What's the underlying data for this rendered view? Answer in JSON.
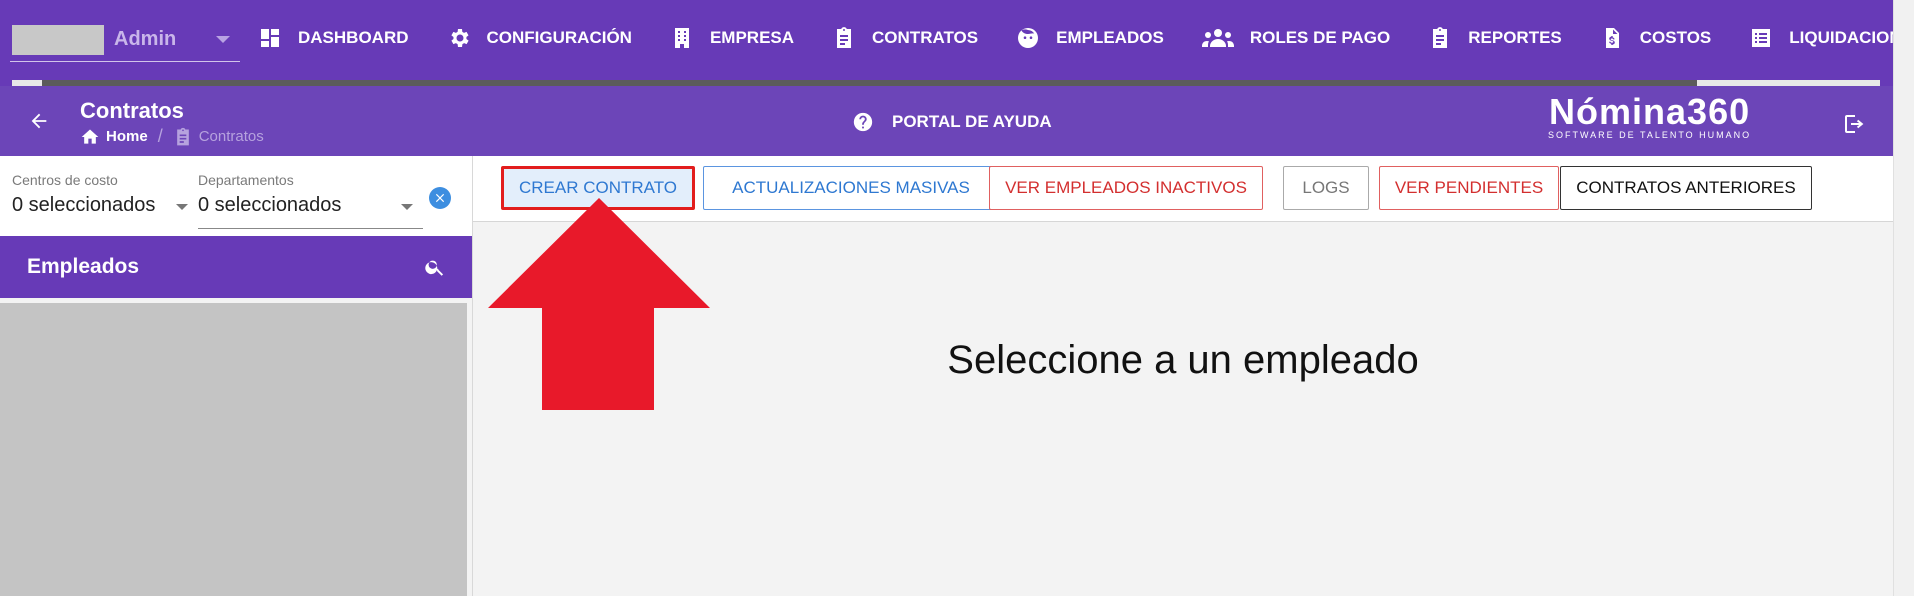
{
  "topbar": {
    "company_name": "Admin",
    "nav": [
      {
        "label": "DASHBOARD",
        "icon": "dashboard-icon"
      },
      {
        "label": "CONFIGURACIÓN",
        "icon": "gear-icon"
      },
      {
        "label": "EMPRESA",
        "icon": "building-icon"
      },
      {
        "label": "CONTRATOS",
        "icon": "clipboard-icon"
      },
      {
        "label": "EMPLEADOS",
        "icon": "face-icon"
      },
      {
        "label": "ROLES DE PAGO",
        "icon": "people-icon"
      },
      {
        "label": "REPORTES",
        "icon": "clipboard-icon"
      },
      {
        "label": "COSTOS",
        "icon": "invoice-dollar-icon"
      },
      {
        "label": "LIQUIDACIONES",
        "icon": "list-icon"
      }
    ]
  },
  "subbar": {
    "title": "Contratos",
    "breadcrumb": {
      "home": "Home",
      "current": "Contratos"
    },
    "help": "PORTAL DE AYUDA",
    "brand": {
      "name": "Nómina360",
      "tagline": "SOFTWARE DE TALENTO HUMANO"
    }
  },
  "filters": {
    "centros": {
      "label": "Centros de costo",
      "value": "0 seleccionados"
    },
    "departamentos": {
      "label": "Departamentos",
      "value": "0 seleccionados"
    }
  },
  "employees": {
    "title": "Empleados"
  },
  "actions": {
    "crear": "CREAR CONTRATO",
    "masivas": "ACTUALIZACIONES MASIVAS",
    "inactivos": "VER EMPLEADOS INACTIVOS",
    "logs": "LOGS",
    "pendientes": "VER PENDIENTES",
    "anteriores": "CONTRATOS ANTERIORES"
  },
  "main": {
    "empty_message": "Seleccione a un empleado"
  },
  "colors": {
    "primary": "#673ab7",
    "accent_blue": "#2e78d1",
    "accent_red": "#d32f2f",
    "highlight": "#e21d1d"
  }
}
